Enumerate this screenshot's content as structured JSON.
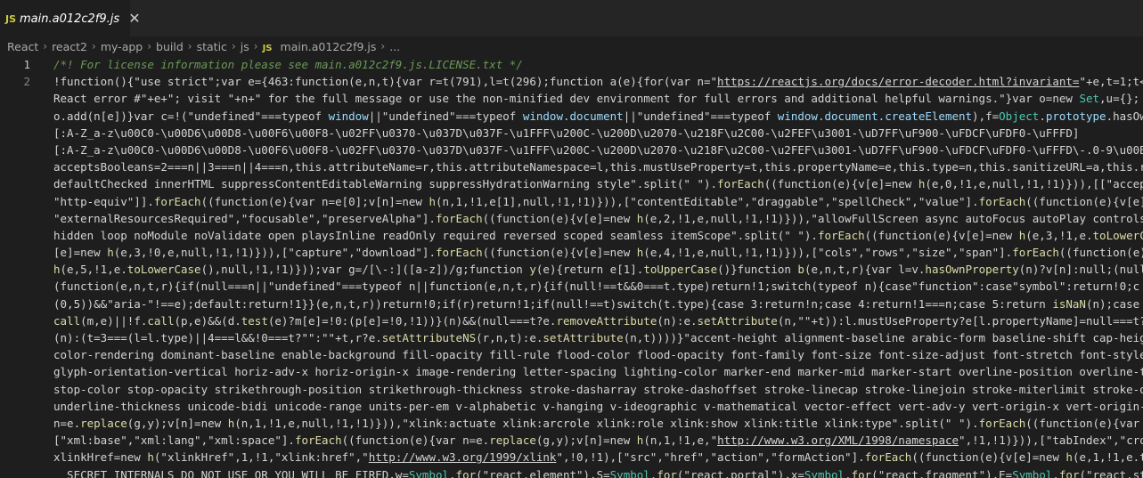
{
  "tab": {
    "icon": "JS",
    "title": "main.a012c2f9.js",
    "close": "✕"
  },
  "breadcrumb": {
    "items": [
      "React",
      "react2",
      "my-app",
      "build",
      "static",
      "js"
    ],
    "file_icon": "JS",
    "file": "main.a012c2f9.js",
    "ellipsis": "..."
  },
  "editor": {
    "line_numbers": [
      "1",
      "2"
    ],
    "lines": [
      [
        {
          "t": "/*! For license information please see main.a012c2f9.js.LICENSE.txt */",
          "c": "comment"
        }
      ],
      [
        {
          "t": "!function(){\"use strict\";var e={463:function(e,n,t){var r=t(791),l=t(296);function a(e){for(var n=\"",
          "c": "plain"
        },
        {
          "t": "https://reactjs.org/docs/error-decoder.html?invariant=",
          "c": "url"
        },
        {
          "t": "\"+e,t=1;t<",
          "c": "plain"
        }
      ],
      [
        {
          "t": "React error #\"+e+\"; visit \"+n+\" for the full message or use the non-minified dev environment for full errors and additional helpful warnings.\"}var o=new ",
          "c": "plain"
        },
        {
          "t": "Set",
          "c": "type"
        },
        {
          "t": ",u={};",
          "c": "plain"
        }
      ],
      [
        {
          "t": "o.add(n[e])}var c=!(\"undefined\"===typeof ",
          "c": "plain"
        },
        {
          "t": "window",
          "c": "var"
        },
        {
          "t": "||\"undefined\"===typeof ",
          "c": "plain"
        },
        {
          "t": "window.document",
          "c": "var"
        },
        {
          "t": "||\"undefined\"===typeof ",
          "c": "plain"
        },
        {
          "t": "window.document.createElement",
          "c": "var"
        },
        {
          "t": "),f=",
          "c": "plain"
        },
        {
          "t": "Object",
          "c": "type"
        },
        {
          "t": ".",
          "c": "plain"
        },
        {
          "t": "prototype",
          "c": "var"
        },
        {
          "t": ".hasOwn",
          "c": "plain"
        }
      ],
      [
        {
          "t": "[:A-Z_a-z\\u00C0-\\u00D6\\u00D8-\\u00F6\\u00F8-\\u02FF\\u0370-\\u037D\\u037F-\\u1FFF\\u200C-\\u200D\\u2070-\\u218F\\u2C00-\\u2FEF\\u3001-\\uD7FF\\uF900-\\uFDCF\\uFDF0-\\uFFFD]",
          "c": "plain"
        }
      ],
      [
        {
          "t": "[:A-Z_a-z\\u00C0-\\u00D6\\u00D8-\\u00F6\\u00F8-\\u02FF\\u0370-\\u037D\\u037F-\\u1FFF\\u200C-\\u200D\\u2070-\\u218F\\u2C00-\\u2FEF\\u3001-\\uD7FF\\uF900-\\uFDCF\\uFDF0-\\uFFFD\\-.0-9\\u00B7",
          "c": "plain"
        }
      ],
      [
        {
          "t": "acceptsBooleans=2===n||3===n||4===n,this.attributeName=r,this.attributeNamespace=l,this.mustUseProperty=t,this.propertyName=e,this.type=n,this.sanitizeURL=a,this.remov",
          "c": "plain"
        }
      ],
      [
        {
          "t": "defaultChecked innerHTML suppressContentEditableWarning suppressHydrationWarning style\".split(\" \").",
          "c": "plain"
        },
        {
          "t": "forEach",
          "c": "fn"
        },
        {
          "t": "((function(e){v[e]=new ",
          "c": "plain"
        },
        {
          "t": "h",
          "c": "fn"
        },
        {
          "t": "(e,0,!1,e,null,!1,!1)})),[[\"acceptC",
          "c": "plain"
        }
      ],
      [
        {
          "t": "\"http-equiv\"]].",
          "c": "plain"
        },
        {
          "t": "forEach",
          "c": "fn"
        },
        {
          "t": "((function(e){var n=e[0];v[n]=new ",
          "c": "plain"
        },
        {
          "t": "h",
          "c": "fn"
        },
        {
          "t": "(n,1,!1,e[1],null,!1,!1)})),[\"contentEditable\",\"draggable\",\"spellCheck\",\"value\"].",
          "c": "plain"
        },
        {
          "t": "forEach",
          "c": "fn"
        },
        {
          "t": "((function(e){v[e]",
          "c": "plain"
        }
      ],
      [
        {
          "t": "\"externalResourcesRequired\",\"focusable\",\"preserveAlpha\"].",
          "c": "plain"
        },
        {
          "t": "forEach",
          "c": "fn"
        },
        {
          "t": "((function(e){v[e]=new ",
          "c": "plain"
        },
        {
          "t": "h",
          "c": "fn"
        },
        {
          "t": "(e,2,!1,e,null,!1,!1)})),\"allowFullScreen async autoFocus autoPlay controls d",
          "c": "plain"
        }
      ],
      [
        {
          "t": "hidden loop noModule noValidate open playsInline readOnly required reversed scoped seamless itemScope\".split(\" \").",
          "c": "plain"
        },
        {
          "t": "forEach",
          "c": "fn"
        },
        {
          "t": "((function(e){v[e]=new ",
          "c": "plain"
        },
        {
          "t": "h",
          "c": "fn"
        },
        {
          "t": "(e,3,!1,e.",
          "c": "plain"
        },
        {
          "t": "toLowerCase",
          "c": "fn"
        }
      ],
      [
        {
          "t": "[e]=new ",
          "c": "plain"
        },
        {
          "t": "h",
          "c": "fn"
        },
        {
          "t": "(e,3,!0,e,null,!1,!1)})),[\"capture\",\"download\"].",
          "c": "plain"
        },
        {
          "t": "forEach",
          "c": "fn"
        },
        {
          "t": "((function(e){v[e]=new ",
          "c": "plain"
        },
        {
          "t": "h",
          "c": "fn"
        },
        {
          "t": "(e,4,!1,e,null,!1,!1)})),[\"cols\",\"rows\",\"size\",\"span\"].",
          "c": "plain"
        },
        {
          "t": "forEach",
          "c": "fn"
        },
        {
          "t": "((function(e){v[e]",
          "c": "plain"
        }
      ],
      [
        {
          "t": "h",
          "c": "fn"
        },
        {
          "t": "(e,5,!1,e.",
          "c": "plain"
        },
        {
          "t": "toLowerCase",
          "c": "fn"
        },
        {
          "t": "(),null,!1,!1)}));var g=/[\\-:]([a-z])/g;function ",
          "c": "plain"
        },
        {
          "t": "y",
          "c": "fn"
        },
        {
          "t": "(e){return e[1].",
          "c": "plain"
        },
        {
          "t": "toUpperCase",
          "c": "fn"
        },
        {
          "t": "()}function ",
          "c": "plain"
        },
        {
          "t": "b",
          "c": "fn"
        },
        {
          "t": "(e,n,t,r){var l=v.",
          "c": "plain"
        },
        {
          "t": "hasOwnProperty",
          "c": "fn"
        },
        {
          "t": "(n)?v[n]:null;(null",
          "c": "plain"
        }
      ],
      [
        {
          "t": "(function(e,n,t,r){if(null===n||\"undefined\"===typeof n||function(e,n,t,r){if(null!==t&&0===t.type)return!1;switch(typeof n){case\"function\":case\"symbol\":return!0;c",
          "c": "plain"
        }
      ],
      [
        {
          "t": "(0,5))&&\"aria-\"!==e);default:return!1}}(e,n,t,r))return!0;if(r)return!1;if(null!==t)switch(t.type){case 3:return!n;case 4:return!1===n;case 5:return ",
          "c": "plain"
        },
        {
          "t": "isNaN",
          "c": "fn"
        },
        {
          "t": "(n);case",
          "c": "plain"
        }
      ],
      [
        {
          "t": "call",
          "c": "fn"
        },
        {
          "t": "(m,e)||!f.",
          "c": "plain"
        },
        {
          "t": "call",
          "c": "fn"
        },
        {
          "t": "(p,e)&&(d.",
          "c": "plain"
        },
        {
          "t": "test",
          "c": "fn"
        },
        {
          "t": "(e)?m[e]=!0:(p[e]=!0,!1))}(n)&&(null===t?e.",
          "c": "plain"
        },
        {
          "t": "removeAttribute",
          "c": "fn"
        },
        {
          "t": "(n):e.",
          "c": "plain"
        },
        {
          "t": "setAttribute",
          "c": "fn"
        },
        {
          "t": "(n,\"\"+t)):l.mustUseProperty?e[l.propertyName]=null===t?",
          "c": "plain"
        }
      ],
      [
        {
          "t": "(n):(t=3===(l=l.type)||4===l&&!0===t?\"\":\"\"+t,r?e.",
          "c": "plain"
        },
        {
          "t": "setAttributeNS",
          "c": "fn"
        },
        {
          "t": "(r,n,t):e.",
          "c": "plain"
        },
        {
          "t": "setAttribute",
          "c": "fn"
        },
        {
          "t": "(n,t))))}\"accent-height alignment-baseline arabic-form baseline-shift cap-height",
          "c": "plain"
        }
      ],
      [
        {
          "t": "color-rendering dominant-baseline enable-background fill-opacity fill-rule flood-color flood-opacity font-family font-size font-size-adjust font-stretch font-style",
          "c": "plain"
        }
      ],
      [
        {
          "t": "glyph-orientation-vertical horiz-adv-x horiz-origin-x image-rendering letter-spacing lighting-color marker-end marker-mid marker-start overline-position overline-thi",
          "c": "plain"
        }
      ],
      [
        {
          "t": "stop-color stop-opacity strikethrough-position strikethrough-thickness stroke-dasharray stroke-dashoffset stroke-linecap stroke-linejoin stroke-miterlimit stroke-opacit",
          "c": "plain"
        }
      ],
      [
        {
          "t": "underline-thickness unicode-bidi unicode-range units-per-em v-alphabetic v-hanging v-ideographic v-mathematical vector-effect vert-adv-y vert-origin-x vert-origin-y",
          "c": "plain"
        }
      ],
      [
        {
          "t": "n=e.",
          "c": "plain"
        },
        {
          "t": "replace",
          "c": "fn"
        },
        {
          "t": "(g,y);v[n]=new ",
          "c": "plain"
        },
        {
          "t": "h",
          "c": "fn"
        },
        {
          "t": "(n,1,!1,e,null,!1,!1)})),\"xlink:actuate xlink:arcrole xlink:role xlink:show xlink:title xlink:type\".split(\" \").",
          "c": "plain"
        },
        {
          "t": "forEach",
          "c": "fn"
        },
        {
          "t": "((function(e){var n",
          "c": "plain"
        }
      ],
      [
        {
          "t": "[\"xml:base\",\"xml:lang\",\"xml:space\"].",
          "c": "plain"
        },
        {
          "t": "forEach",
          "c": "fn"
        },
        {
          "t": "((function(e){var n=e.",
          "c": "plain"
        },
        {
          "t": "replace",
          "c": "fn"
        },
        {
          "t": "(g,y);v[n]=new ",
          "c": "plain"
        },
        {
          "t": "h",
          "c": "fn"
        },
        {
          "t": "(n,1,!1,e,\"",
          "c": "plain"
        },
        {
          "t": "http://www.w3.org/XML/1998/namespace",
          "c": "url"
        },
        {
          "t": "\",!1,!1)})),[\"tabIndex\",\"crossO",
          "c": "plain"
        }
      ],
      [
        {
          "t": "xlinkHref=new ",
          "c": "plain"
        },
        {
          "t": "h",
          "c": "fn"
        },
        {
          "t": "(\"xlinkHref\",1,!1,\"xlink:href\",\"",
          "c": "plain"
        },
        {
          "t": "http://www.w3.org/1999/xlink",
          "c": "url"
        },
        {
          "t": "\",!0,!1),[\"src\",\"href\",\"action\",\"formAction\"].",
          "c": "plain"
        },
        {
          "t": "forEach",
          "c": "fn"
        },
        {
          "t": "((function(e){v[e]=new ",
          "c": "plain"
        },
        {
          "t": "h",
          "c": "fn"
        },
        {
          "t": "(e,1,!1,e.to",
          "c": "plain"
        }
      ],
      [
        {
          "t": "__SECRET_INTERNALS_DO_NOT_USE_OR_YOU_WILL_BE_FIRED,w=",
          "c": "plain"
        },
        {
          "t": "Symbol",
          "c": "type"
        },
        {
          "t": ".",
          "c": "plain"
        },
        {
          "t": "for",
          "c": "fn"
        },
        {
          "t": "(\"react.element\"),S=",
          "c": "plain"
        },
        {
          "t": "Symbol",
          "c": "type"
        },
        {
          "t": ".",
          "c": "plain"
        },
        {
          "t": "for",
          "c": "fn"
        },
        {
          "t": "(\"react.portal\"),x=",
          "c": "plain"
        },
        {
          "t": "Symbol",
          "c": "type"
        },
        {
          "t": ".",
          "c": "plain"
        },
        {
          "t": "for",
          "c": "fn"
        },
        {
          "t": "(\"react.fragment\"),E=",
          "c": "plain"
        },
        {
          "t": "Symbol",
          "c": "type"
        },
        {
          "t": ".",
          "c": "plain"
        },
        {
          "t": "for",
          "c": "fn"
        },
        {
          "t": "(\"react.stri",
          "c": "plain"
        }
      ]
    ]
  }
}
